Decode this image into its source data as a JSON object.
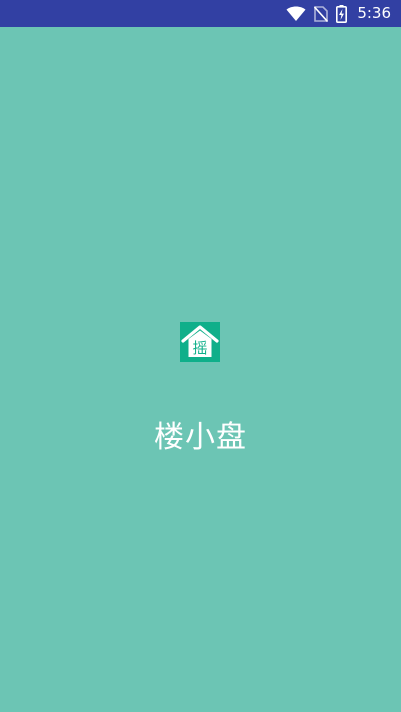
{
  "status_bar": {
    "time": "5:36",
    "background_color": "#3240A3",
    "icons": [
      "wifi-icon",
      "no-sim-icon",
      "battery-charging-icon"
    ]
  },
  "splash": {
    "background_color": "#6CC5B4",
    "logo": {
      "icon": "house-logo-icon",
      "glyph": "摇",
      "color": "#0FAF8A"
    },
    "app_name": "楼小盘"
  }
}
